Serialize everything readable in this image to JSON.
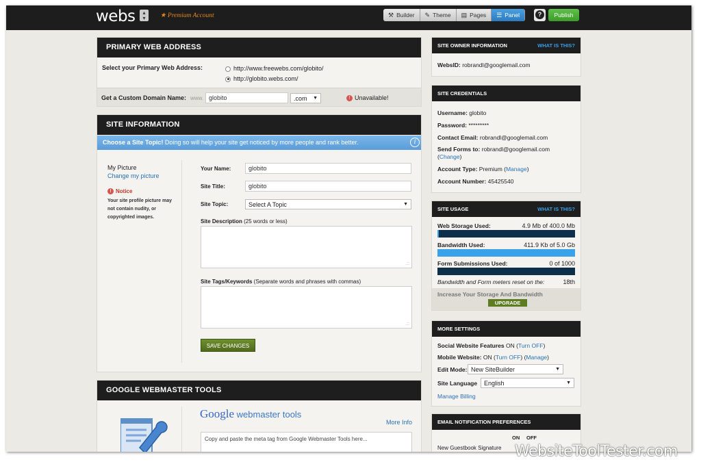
{
  "topbar": {
    "logo": "webs",
    "premium": "★ Premium Account",
    "tabs": [
      {
        "icon": "⚒",
        "label": "Builder"
      },
      {
        "icon": "✎",
        "label": "Theme"
      },
      {
        "icon": "▤",
        "label": "Pages"
      },
      {
        "icon": "☰",
        "label": "Panel"
      }
    ],
    "help": "?",
    "publish": "Publish"
  },
  "primary": {
    "title": "Primary Web Address",
    "select_label": "Select your Primary Web Address:",
    "options": [
      "http://www.freewebs.com/globito/",
      "http://globito.webs.com/"
    ],
    "custom_label": "Get a Custom Domain Name:",
    "www": "www.",
    "domain_value": "globito",
    "tld": ".com",
    "status": "Unavailable!",
    "status_icon": "!"
  },
  "site_info": {
    "title": "Site Information",
    "banner_bold": "Choose a Site Topic!",
    "banner_text": " Doing so will help your site get noticed by more people and rank better.",
    "banner_icon": "i",
    "my_picture": "My Picture",
    "change_picture": "Change my picture",
    "notice_title": "Notice",
    "notice_text": "Your site profile picture may not contain nudity, or copyrighted images.",
    "your_name_label": "Your Name:",
    "your_name_value": "globito",
    "site_title_label": "Site Title:",
    "site_title_value": "globito",
    "site_topic_label": "Site Topic:",
    "site_topic_value": "Select A Topic",
    "desc_label": "Site Description",
    "desc_hint": " (25 words or less)",
    "tags_label": "Site Tags/Keywords",
    "tags_hint": " (Separate words and phrases with commas)",
    "save": "SAVE CHANGES"
  },
  "gwt": {
    "title": "Google Webmaster Tools",
    "google": "Google",
    "webmaster": " webmaster tools",
    "more_info": "More Info",
    "placeholder": "Copy and paste the meta tag from Google Webmaster Tools here..."
  },
  "owner": {
    "title": "Site Owner Information",
    "what": "What is this?",
    "websid_label": "WebsID:",
    "websid_value": " robrandl@googlemail.com"
  },
  "credentials": {
    "title": "Site Credentials",
    "username_label": "Username:",
    "username_value": " globito",
    "password_label": "Password:",
    "password_value": " *********",
    "contact_label": "Contact Email:",
    "contact_value": " robrandl@googlemail.com",
    "send_label": "Send Forms to:",
    "send_value": " robrandl@googlemail.com",
    "change": "Change",
    "type_label": "Account Type:",
    "type_value": " Premium (",
    "manage": "Manage",
    "number_label": "Account Number:",
    "number_value": " 45425540"
  },
  "usage": {
    "title": "Site Usage",
    "what": "What is this?",
    "storage_label": "Web Storage Used:",
    "storage_value": "4.9 Mb of 400.0 Mb",
    "storage_fraction": 0.012,
    "bandwidth_label": "Bandwidth Used:",
    "bandwidth_value": "411.9 Kb of 5.0 Gb",
    "bandwidth_fraction": 1.0,
    "forms_label": "Form Submissions Used:",
    "forms_value": "0 of 1000",
    "forms_fraction": 0.0,
    "reset_text": "Bandwidth and Form meters reset on the:",
    "reset_value": "18th",
    "increase": "Increase Your Storage And Bandwidth",
    "upgrade": "UPGRADE"
  },
  "more": {
    "title": "More Settings",
    "social_label": "Social Website Features",
    "social_value": " ON (",
    "turn_off": "Turn OFF",
    "mobile_label": "Mobile Website:",
    "mobile_value": " ON (",
    "mobile_turn_off": "Turn OFF",
    "mobile_manage": "Manage",
    "edit_label": "Edit Mode:",
    "edit_value": "New SiteBuilder",
    "lang_label": "Site Language",
    "lang_value": "English",
    "billing": "Manage Billing"
  },
  "email": {
    "title": "Email Notification Preferences",
    "on": "ON",
    "off": "OFF",
    "row1": "New Guestbook Signature"
  },
  "watermark": "WebsiteToolTester.com"
}
